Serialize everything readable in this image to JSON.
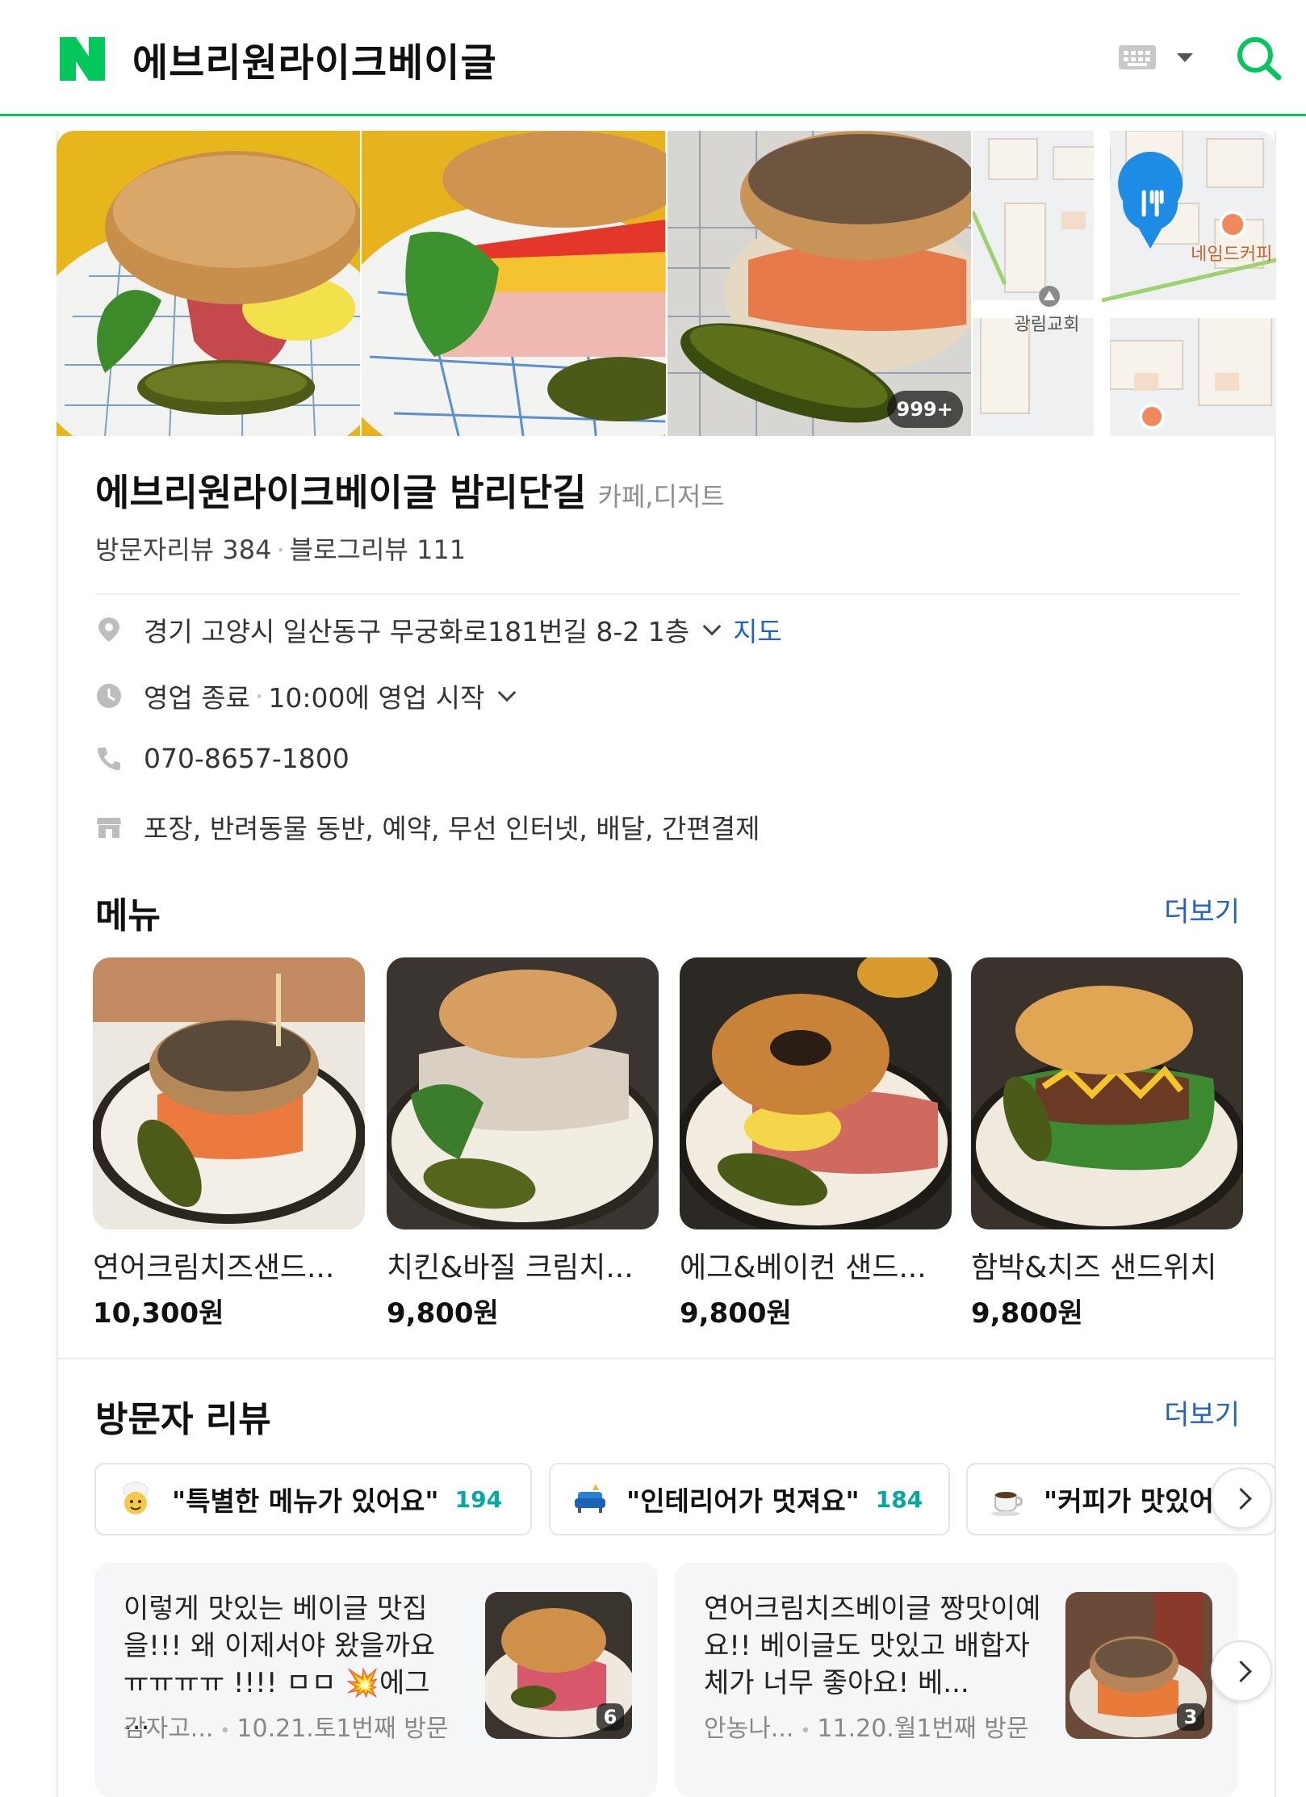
{
  "search": {
    "query": "에브리원라이크베이글"
  },
  "photos": {
    "count_badge": "999+",
    "map_labels": [
      "네임드커피",
      "광림교회"
    ]
  },
  "place": {
    "name": "에브리원라이크베이글 밤리단길",
    "category": "카페,디저트",
    "visitor_reviews": "방문자리뷰 384",
    "blog_reviews": "블로그리뷰 111",
    "address": "경기 고양시 일산동구 무궁화로181번길 8-2 1층",
    "map_link": "지도",
    "status": "영업 종료",
    "hours": "10:00에 영업 시작",
    "phone": "070-8657-1800",
    "amenities": "포장, 반려동물 동반, 예약, 무선 인터넷, 배달, 간편결제"
  },
  "menu": {
    "title": "메뉴",
    "more": "더보기",
    "items": [
      {
        "name": "연어크림치즈샌드...",
        "price": "10,300원"
      },
      {
        "name": "치킨&바질 크림치...",
        "price": "9,800원"
      },
      {
        "name": "에그&베이컨 샌드...",
        "price": "9,800원"
      },
      {
        "name": "함박&치즈 샌드위치",
        "price": "9,800원"
      }
    ]
  },
  "reviews": {
    "title": "방문자 리뷰",
    "more": "더보기",
    "keywords": [
      {
        "text": "\"특별한 메뉴가 있어요\"",
        "count": "194",
        "icon": "chef-emoji-icon"
      },
      {
        "text": "\"인테리어가 멋져요\"",
        "count": "184",
        "icon": "sofa-emoji-icon"
      },
      {
        "text": "\"커피가 맛있어요\"",
        "count": "",
        "icon": "coffee-emoji-icon"
      }
    ],
    "cards": [
      {
        "text": "이렇게 맛있는 베이글 맛집을!!! 왜 이제서야 왔을까요 ㅠㅠㅠㅠ !!!! ㅁㅁ 💥에그 ...",
        "author": "감자고...",
        "visit": "10.21.토1번째 방문",
        "photo_count": "6"
      },
      {
        "text": "연어크림치즈베이글 짱맛이예요!! 베이글도 맛있고 배합자체가 너무 좋아요! 베...",
        "author": "안농나...",
        "visit": "11.20.월1번째 방문",
        "photo_count": "3"
      }
    ]
  },
  "colors": {
    "brand": "#03c75a",
    "link": "#2063c4",
    "count": "#03a9a0"
  }
}
